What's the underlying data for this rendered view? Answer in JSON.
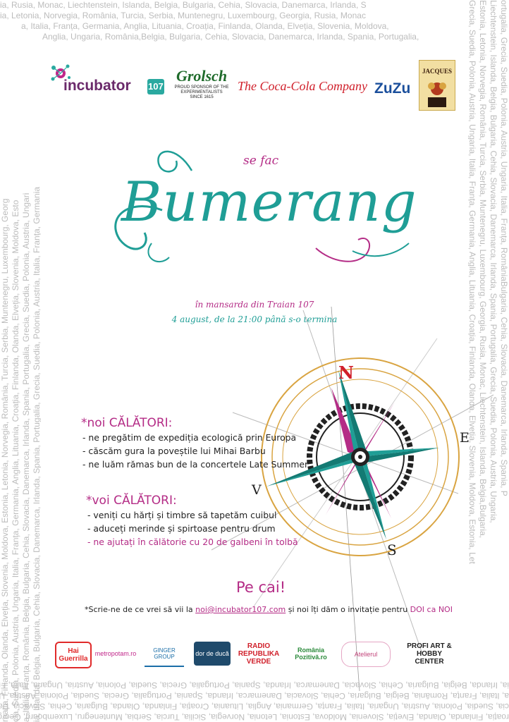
{
  "border": {
    "top_lines": [
      "ia, Rusia, Monac, Liechtenstein, Islanda, Belgia, Bulgaria, Cehia, Slovacia, Danemarca, Irlanda, S",
      "ia, Letonia, Norvegia, România, Turcia, Serbia, Muntenegru, Luxembourg, Georgia, Rusia, Monac",
      "a, Italia, Franța, Germania, Anglia, Lituania, Croația, Finlanda, Olanda, Elveția, Slovenia, Moldova,",
      "Anglia, Ungaria, România,Belgia, Bulgaria, Cehia, Slovacia, Danemarca, Irlanda, Spania, Portugalia,"
    ],
    "bottom_lines": [
      "roația, Finlanda, Olanda, Elveția, Slovenia, Moldova, Estonia, Letonia, Norvegia, Sicilia, Turcia, Serbia, Muntenegru, Luxembourg, Georgia, Rusia, Monac, Liechtenstein",
      "cia, Suedia, Polonia, Austria, Ungaria, Italia, Franța, Germania, Anglia, Lituania, Croația, Finlanda, Olanda, Bulgaria, Cehia, Slovacia, Danemarca, Irlanda, Spania",
      "a, Italia, Franța, România, Belgia, Bulgaria, Cehia, Slovacia, Danemarca, Irlanda, Spania, Portugalia, Grecia, Suedia, Polonia, Austria, Ungari",
      "ia, Irlanda, Belgia, Bulgaria, Cehia, Slovacia, Danemarca, Irlanda, Spania, Portugalia, Grecia, Suedia, Polonia, Austria, Ungaria, Italia, Franța, Germania, Anglia, Lituania"
    ],
    "left_lines": [
      "roația, Finlanda, Olanda, Elveția, Slovenia, Moldova, Estonia, Letonia, Norvegia, România, Turcia, Serbia, Muntenegru, Luxembourg, Georg",
      "cia, Suedia, Polonia, Austria, Ungaria, Italia, Franța, Germania, Anglia, Lituania, Croația, Finlanda, Olanda, Elveția, Slovenia, Moldova, Esto",
      "a, Italia, Franța, România, Belgia, Bulgaria, Cehia, Slovacia, Danemarca, Irlanda, Spania, Portugalia, Grecia, Suedia, Polonia, Austria, Ungari",
      "ia, Irlanda, Belgia, Bulgaria, Cehia, Slovacia, Danemarca, Irlanda, Spania, Portugalia, Grecia, Suedia, Polonia, Austria, Italia, Franța, Germania"
    ],
    "right_lines": [
      "ortugalia, Grecia, Suedia, Polonia, Austria, Ungaria, Italia, Franța, RomâniaBulgaria, Cehia, Slovacia, Danemarca, Irlanda, Spania, P",
      "Liechtenstein, Islanda, Belgia, Bulgaria, Cehia, Slovacia, Danemarca, Irlanda, Spania, Portugalia, Grecia, Suedia, Polonia, Austria, Ungaria,",
      "Estonia, Letonia, Norvegia, România, Turcia, Serbia, Muntenegru, Luxembourg, Georgia, Rusia, Monac, Liechtenstein, Islanda, Belgia,Bulgaria,",
      "Grecia, Suedia, Polonia, Austria, Ungaria, Italia, Franța, Germania, Anglia, Lituania, Croația, Finlanda, Olanda, Elveția, Slovenia, Moldova, Estonia, Let"
    ]
  },
  "sponsors": {
    "incubator": "incubator",
    "incubator_badge": "107",
    "grolsch": "Grolsch",
    "grolsch_tag": "PROUD SPONSOR OF THE EXPERIMENTALISTS SINCE 1615",
    "coke": "The Coca-Cola Company",
    "zuzu": "ZuZu",
    "jacques": "JACQUES"
  },
  "headline": {
    "pre": "se fac",
    "title": "Bumerang",
    "venue": "în mansarda din Traian 107",
    "date": "4 august, de la 21:00 până s-o termina"
  },
  "compass": {
    "n": "N",
    "e": "E",
    "s": "S",
    "w": "V"
  },
  "noi": {
    "title": "*noi CĂLĂTORI:",
    "items": [
      "- ne pregătim de expediția ecologică prin Europa",
      "- căscăm gura la poveștile lui Mihai Barbu",
      "- ne luăm rămas bun de la concertele Late Summer"
    ]
  },
  "voi": {
    "title": "*voi CĂLĂTORI:",
    "items": [
      "- veniți cu hărți și timbre să tapetăm cuibul",
      "- aduceți merinde și spirtoase pentru drum",
      "- ne ajutați în călătorie cu 20 de galbeni în tolbă"
    ]
  },
  "closing": {
    "cta": "Pe cai!",
    "invite_pre": "*Scrie-ne de ce vrei să vii la",
    "email": "noi@incubator107.com",
    "invite_mid": "și noi îți dăm o invitație pentru",
    "invite_end": "DOI ca NOI"
  },
  "partners": [
    "Hai Guerrilla",
    "metropotam.ro",
    "GINGER GROUP",
    "dor de ducă",
    "RADIO REPUBLIKA VERDE",
    "România Pozitivă.ro",
    "Atelierul",
    "PROFI ART & HOBBY CENTER"
  ],
  "colors": {
    "teal": "#1f9e96",
    "magenta": "#b42c86",
    "gold": "#d9a441",
    "border_text": "#bcbcbc"
  }
}
